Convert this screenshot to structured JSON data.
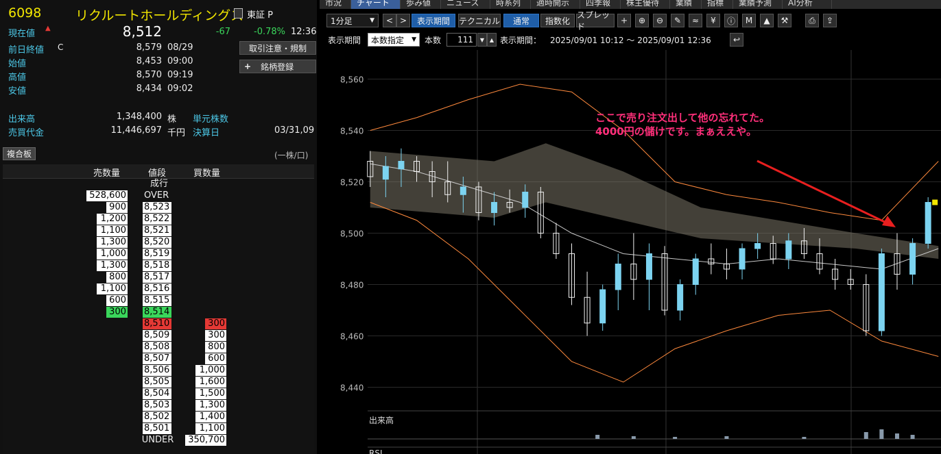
{
  "stock": {
    "code": "6098",
    "name": "リクルートホールディングス",
    "exchange": "東証 P",
    "current_label": "現在値",
    "current_value": "8,512",
    "change": "-67",
    "change_pct": "-0.78%",
    "current_time": "12:36"
  },
  "quotes": [
    {
      "label": "前日終値",
      "flag": "C",
      "value": "8,579",
      "time": "08/29"
    },
    {
      "label": "始値",
      "flag": "",
      "value": "8,453",
      "time": "09:00"
    },
    {
      "label": "高値",
      "flag": "",
      "value": "8,570",
      "time": "09:19"
    },
    {
      "label": "安値",
      "flag": "",
      "value": "8,434",
      "time": "09:02"
    }
  ],
  "stats": {
    "volume_label": "出来高",
    "volume_value": "1,348,400",
    "volume_unit": "株",
    "unit_label": "単元株数",
    "turnover_label": "売買代金",
    "turnover_value": "11,446,697",
    "turnover_unit": "千円",
    "settle_label": "決算日",
    "settle_value": "03/31,09"
  },
  "buttons": {
    "trade_notice": "取引注意・規制",
    "register": "銘柄登録",
    "register_icon": "+"
  },
  "board": {
    "tab": "複合板",
    "unit_note": "(一株/口)",
    "headers": {
      "sell": "売数量",
      "price": "値段",
      "buy": "買数量"
    },
    "market_label": "成行",
    "over": {
      "sell": "528,600",
      "label": "OVER"
    },
    "asks": [
      {
        "sell": "900",
        "price": "8,523"
      },
      {
        "sell": "1,200",
        "price": "8,522"
      },
      {
        "sell": "1,100",
        "price": "8,521"
      },
      {
        "sell": "1,300",
        "price": "8,520"
      },
      {
        "sell": "1,000",
        "price": "8,519"
      },
      {
        "sell": "1,300",
        "price": "8,518"
      },
      {
        "sell": "800",
        "price": "8,517"
      },
      {
        "sell": "1,100",
        "price": "8,516"
      },
      {
        "sell": "600",
        "price": "8,515"
      },
      {
        "sell": "300",
        "price": "8,514"
      }
    ],
    "bids": [
      {
        "price": "8,510",
        "buy": "300"
      },
      {
        "price": "8,509",
        "buy": "300"
      },
      {
        "price": "8,508",
        "buy": "800"
      },
      {
        "price": "8,507",
        "buy": "600"
      },
      {
        "price": "8,506",
        "buy": "1,000"
      },
      {
        "price": "8,505",
        "buy": "1,600"
      },
      {
        "price": "8,504",
        "buy": "1,500"
      },
      {
        "price": "8,503",
        "buy": "1,300"
      },
      {
        "price": "8,502",
        "buy": "1,400"
      },
      {
        "price": "8,501",
        "buy": "1,100"
      }
    ],
    "under": {
      "label": "UNDER",
      "buy": "350,700"
    }
  },
  "tabs": [
    "市況",
    "チャート",
    "歩み値",
    "ニュース",
    "時系列",
    "適時開示",
    "四季報",
    "株主優待",
    "業績",
    "指標",
    "業績予測",
    "AI分析"
  ],
  "active_tab": 1,
  "toolbar": {
    "interval": "1分足",
    "period_btn": "表示期間",
    "technical_btn": "テクニカル",
    "normal_btn": "通常",
    "index_btn": "指数化",
    "spread_btn": "スプレッド",
    "icons": [
      "plus-icon",
      "zoom-in-icon",
      "zoom-out-icon",
      "pencil-icon",
      "chart-type-icon",
      "yen-icon",
      "info-icon",
      "my-icon",
      "area-icon",
      "wrench-icon",
      "print-icon",
      "export-icon"
    ]
  },
  "toolbar2": {
    "period_label": "表示期間",
    "mode": "本数指定",
    "count_label": "本数",
    "count": "111",
    "range_label": "表示期間：",
    "range": "2025/09/01 10:12 ～ 2025/09/01 12:36"
  },
  "annotation": {
    "line1": "ここで売り注文出して他の忘れてた。",
    "line2": "4000円の儲けです。まぁええや。"
  },
  "colors": {
    "accent_yellow": "#f2e600",
    "label_cyan": "#4cc7e6",
    "down_green": "#3ad65b",
    "bid_red": "#e53935",
    "candle_up": "#7cd3f0",
    "annotation": "#ff2f7a"
  },
  "chart_data": {
    "type": "line",
    "xlabel": "",
    "ylabel": "",
    "ylim": [
      8434,
      8566
    ],
    "y_ticks": [
      "8,560",
      "8,540",
      "8,520",
      "8,500",
      "8,480",
      "8,460",
      "8,440"
    ],
    "x_range": [
      "2025/09/01 10:12",
      "2025/09/01 12:36"
    ],
    "bars": 111,
    "candles": [
      {
        "x": 1,
        "o": 8528,
        "h": 8532,
        "l": 8518,
        "c": 8522
      },
      {
        "x": 4,
        "o": 8521,
        "h": 8530,
        "l": 8514,
        "c": 8526
      },
      {
        "x": 7,
        "o": 8525,
        "h": 8533,
        "l": 8518,
        "c": 8528
      },
      {
        "x": 10,
        "o": 8528,
        "h": 8530,
        "l": 8520,
        "c": 8524
      },
      {
        "x": 13,
        "o": 8524,
        "h": 8528,
        "l": 8514,
        "c": 8520
      },
      {
        "x": 16,
        "o": 8520,
        "h": 8528,
        "l": 8512,
        "c": 8515
      },
      {
        "x": 19,
        "o": 8515,
        "h": 8522,
        "l": 8508,
        "c": 8518
      },
      {
        "x": 22,
        "o": 8518,
        "h": 8520,
        "l": 8505,
        "c": 8508
      },
      {
        "x": 25,
        "o": 8508,
        "h": 8516,
        "l": 8503,
        "c": 8512
      },
      {
        "x": 28,
        "o": 8512,
        "h": 8517,
        "l": 8508,
        "c": 8510
      },
      {
        "x": 31,
        "o": 8510,
        "h": 8519,
        "l": 8506,
        "c": 8516
      },
      {
        "x": 34,
        "o": 8516,
        "h": 8518,
        "l": 8498,
        "c": 8500
      },
      {
        "x": 37,
        "o": 8500,
        "h": 8504,
        "l": 8490,
        "c": 8492
      },
      {
        "x": 40,
        "o": 8492,
        "h": 8496,
        "l": 8472,
        "c": 8475
      },
      {
        "x": 43,
        "o": 8475,
        "h": 8485,
        "l": 8460,
        "c": 8465
      },
      {
        "x": 46,
        "o": 8465,
        "h": 8480,
        "l": 8462,
        "c": 8478
      },
      {
        "x": 49,
        "o": 8478,
        "h": 8492,
        "l": 8470,
        "c": 8488
      },
      {
        "x": 52,
        "o": 8488,
        "h": 8500,
        "l": 8474,
        "c": 8482
      },
      {
        "x": 55,
        "o": 8482,
        "h": 8496,
        "l": 8470,
        "c": 8492
      },
      {
        "x": 58,
        "o": 8492,
        "h": 8495,
        "l": 8468,
        "c": 8470
      },
      {
        "x": 61,
        "o": 8470,
        "h": 8482,
        "l": 8466,
        "c": 8480
      },
      {
        "x": 64,
        "o": 8480,
        "h": 8492,
        "l": 8476,
        "c": 8490
      },
      {
        "x": 67,
        "o": 8490,
        "h": 8496,
        "l": 8484,
        "c": 8488
      },
      {
        "x": 70,
        "o": 8488,
        "h": 8494,
        "l": 8482,
        "c": 8486
      },
      {
        "x": 73,
        "o": 8486,
        "h": 8496,
        "l": 8482,
        "c": 8494
      },
      {
        "x": 76,
        "o": 8494,
        "h": 8500,
        "l": 8490,
        "c": 8496
      },
      {
        "x": 79,
        "o": 8496,
        "h": 8499,
        "l": 8488,
        "c": 8490
      },
      {
        "x": 82,
        "o": 8490,
        "h": 8500,
        "l": 8486,
        "c": 8497
      },
      {
        "x": 85,
        "o": 8497,
        "h": 8502,
        "l": 8490,
        "c": 8492
      },
      {
        "x": 88,
        "o": 8492,
        "h": 8498,
        "l": 8484,
        "c": 8486
      },
      {
        "x": 91,
        "o": 8486,
        "h": 8490,
        "l": 8478,
        "c": 8482
      },
      {
        "x": 94,
        "o": 8482,
        "h": 8486,
        "l": 8478,
        "c": 8480
      },
      {
        "x": 97,
        "o": 8480,
        "h": 8484,
        "l": 8460,
        "c": 8462
      },
      {
        "x": 100,
        "o": 8462,
        "h": 8494,
        "l": 8460,
        "c": 8492
      },
      {
        "x": 103,
        "o": 8492,
        "h": 8500,
        "l": 8478,
        "c": 8484
      },
      {
        "x": 106,
        "o": 8484,
        "h": 8498,
        "l": 8480,
        "c": 8496
      },
      {
        "x": 109,
        "o": 8496,
        "h": 8514,
        "l": 8494,
        "c": 8512
      }
    ],
    "series": [
      {
        "values_x": [
          1,
          10,
          20,
          30,
          40,
          50,
          60,
          70,
          80,
          90,
          100,
          111
        ],
        "values": [
          8527,
          8524,
          8518,
          8512,
          8500,
          8492,
          8490,
          8488,
          8490,
          8488,
          8486,
          8494
        ]
      },
      {
        "values_x": [
          1,
          10,
          20,
          30,
          40,
          50,
          60,
          70,
          80,
          90,
          100,
          111
        ],
        "values": [
          8540,
          8545,
          8552,
          8558,
          8555,
          8540,
          8520,
          8515,
          8512,
          8508,
          8505,
          8528
        ]
      },
      {
        "values_x": [
          1,
          10,
          20,
          30,
          40,
          50,
          60,
          70,
          80,
          90,
          100,
          111
        ],
        "values": [
          8512,
          8505,
          8490,
          8470,
          8450,
          8442,
          8455,
          8462,
          8468,
          8470,
          8458,
          8452
        ]
      }
    ],
    "volume_label": "出来高",
    "rsi_label": "RSI"
  }
}
